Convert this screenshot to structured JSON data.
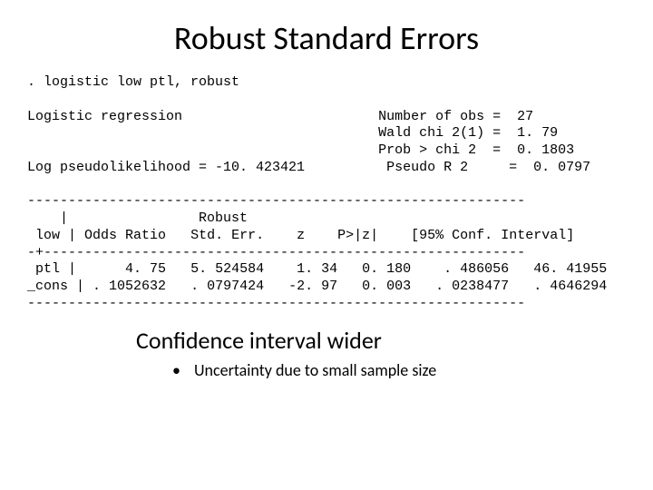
{
  "title": "Robust Standard Errors",
  "command": ". logistic low ptl, robust",
  "hdr_left": "Logistic regression",
  "hdr_loglik": "Log pseudolikelihood = -10. 423421",
  "stats": {
    "nobs_label": "Number of obs",
    "nobs_eq": "=",
    "nobs_val": "27",
    "wald_label": "Wald chi 2(1)",
    "wald_eq": "=",
    "wald_val": "1. 79",
    "prob_label": "Prob > chi 2",
    "prob_eq": "=",
    "prob_val": "0. 1803",
    "r2_label": "Pseudo R 2",
    "r2_eq": "=",
    "r2_val": "0. 0797"
  },
  "tbl": {
    "hline": "-------------------------------------------------------------",
    "robust_word": "Robust",
    "h_var": "low |",
    "h_or": "Odds Ratio",
    "h_se": "Std. Err.",
    "h_z": "z",
    "h_p": "P>|z|",
    "h_ci": "[95% Conf. Interval]",
    "sep": "-+-----------------------------------------------------------",
    "r1_var": "ptl |",
    "r1_or": "4. 75",
    "r1_se": "5. 524584",
    "r1_z": "1. 34",
    "r1_p": "0. 180",
    "r1_cilo": ". 486056",
    "r1_cihi": "46. 41955",
    "r2_var": "_cons |",
    "r2_or": ". 1052632",
    "r2_se": ". 0797424",
    "r2_z": "-2. 97",
    "r2_p": "0. 003",
    "r2_cilo": ". 0238477",
    "r2_cihi": ". 4646294"
  },
  "bottom_heading": "Confidence interval wider",
  "bullet": "Uncertainty due to small sample size",
  "bullet_char": "•"
}
